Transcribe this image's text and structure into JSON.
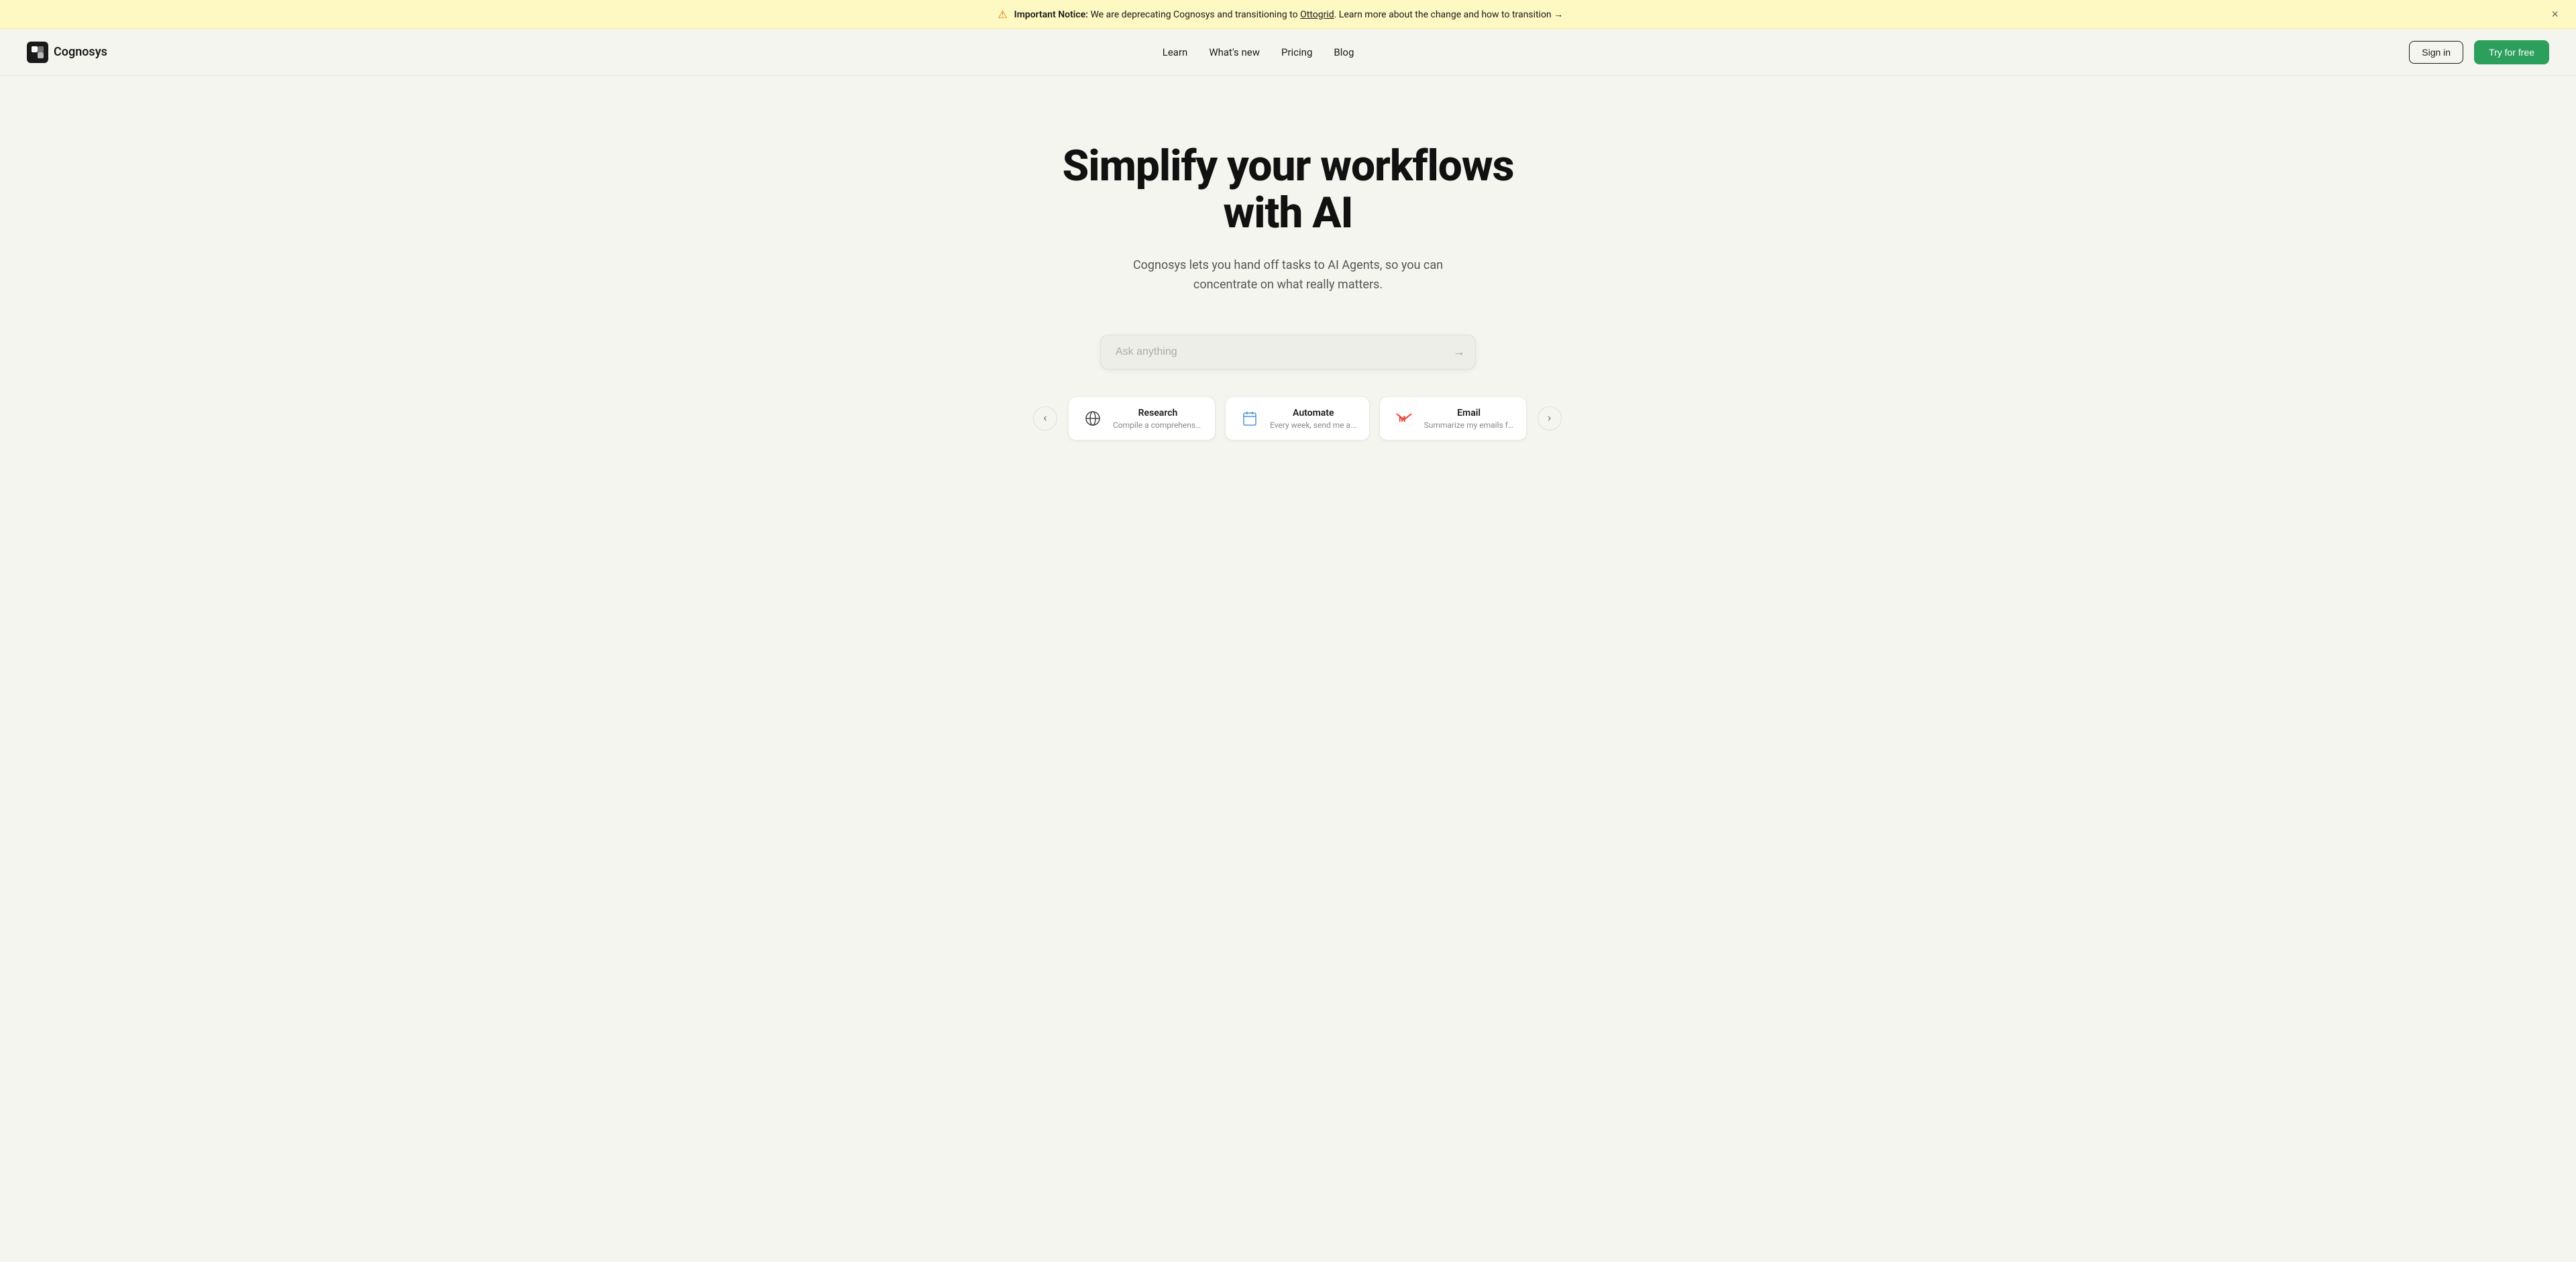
{
  "notice": {
    "prefix": "Important Notice:",
    "text": " We are deprecating Cognosys and transitioning to ",
    "link_text": "Ottogrid",
    "link_suffix": ". Learn more about the change and how to transition →"
  },
  "nav": {
    "logo_text": "Cognosys",
    "links": [
      {
        "label": "Learn",
        "id": "learn"
      },
      {
        "label": "What's new",
        "id": "whats-new"
      },
      {
        "label": "Pricing",
        "id": "pricing"
      },
      {
        "label": "Blog",
        "id": "blog"
      }
    ],
    "sign_in": "Sign in",
    "try_free": "Try for free"
  },
  "hero": {
    "title": "Simplify your workflows with AI",
    "subtitle": "Cognosys lets you hand off tasks to AI Agents, so you can concentrate on what really matters.",
    "input_placeholder": "Ask anything"
  },
  "suggestions": [
    {
      "id": "research",
      "title": "Research",
      "description": "Compile a comprehensive...",
      "icon_type": "globe"
    },
    {
      "id": "automate",
      "title": "Automate",
      "description": "Every week, send me a...",
      "icon_type": "calendar"
    },
    {
      "id": "email",
      "title": "Email",
      "description": "Summarize my emails from...",
      "icon_type": "gmail"
    }
  ],
  "colors": {
    "try_free_bg": "#2d9f5d",
    "banner_bg": "#fef9c3",
    "body_bg": "#f5f5f0"
  }
}
